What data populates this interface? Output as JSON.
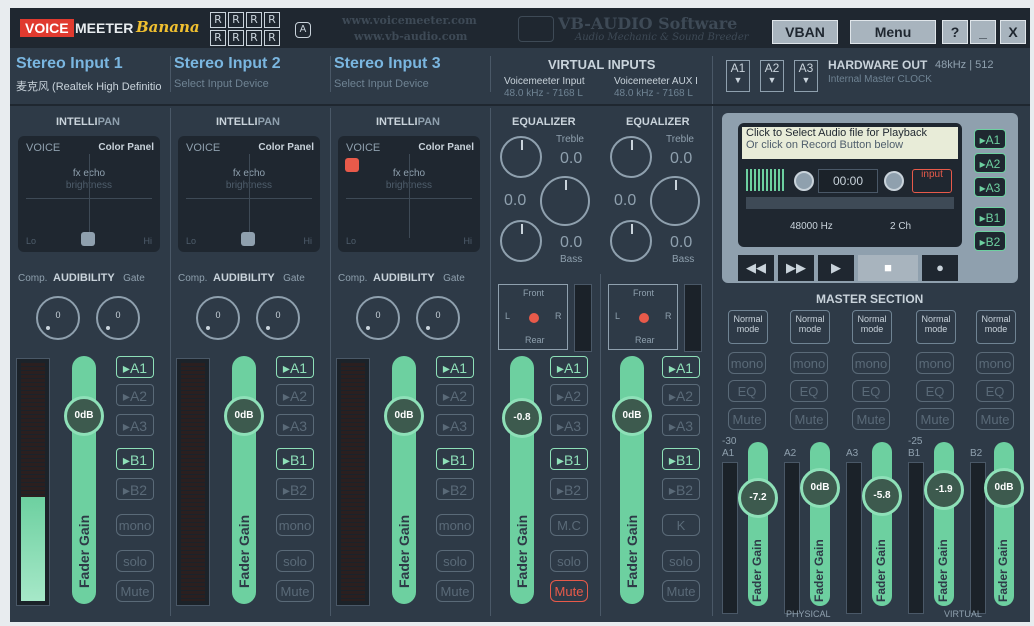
{
  "app": {
    "logo_voice": "VOICE",
    "logo_meeter": "MEETER",
    "logo_banana": "Banana",
    "r_badge": "R",
    "a_badge": "A",
    "watermark_url1": "www.voicemeeter.com",
    "watermark_url2": "www.vb-audio.com",
    "watermark_brand": "VB-AUDIO Software",
    "watermark_slogan": "Audio Mechanic & Sound Breeder",
    "vban": "VBAN",
    "menu": "Menu",
    "help": "?",
    "minimize": "_",
    "close": "X"
  },
  "strips": [
    {
      "title": "Stereo Input 1",
      "sub": "麦克风 (Realtek High Definitio",
      "fader": "0dB"
    },
    {
      "title": "Stereo Input 2",
      "sub": "Select Input Device",
      "fader": "0dB"
    },
    {
      "title": "Stereo Input 3",
      "sub": "Select Input Device",
      "fader": "0dB"
    }
  ],
  "labels": {
    "intellipan_a": "INTELLI",
    "intellipan_b": "PAN",
    "voice": "VOICE",
    "color_panel": "Color Panel",
    "fx_echo": "fx echo",
    "brightness": "brightness",
    "lo": "Lo",
    "hi": "Hi",
    "comp": "Comp.",
    "audibility": "AUDIBILITY",
    "gate": "Gate",
    "knob_zero": "0",
    "fader_gain": "Fader Gain",
    "a1": "▸A1",
    "a2": "▸A2",
    "a3": "▸A3",
    "b1": "▸B1",
    "b2": "▸B2",
    "mono": "mono",
    "solo": "solo",
    "mute": "Mute",
    "mc": "M.C",
    "k": "K",
    "equalizer": "EQUALIZER",
    "treble": "Treble",
    "bass": "Bass",
    "eq_zero": "0.0",
    "front": "Front",
    "rear": "Rear",
    "l": "L",
    "r": "R"
  },
  "virtual_inputs": {
    "title": "VIRTUAL INPUTS",
    "ch1_name": "Voicemeeter Input",
    "ch1_info": "48.0 kHz - 7168 L",
    "ch2_name": "Voicemeeter AUX I",
    "ch2_info": "48.0 kHz - 7168 L",
    "ch1_fader": "-0.8",
    "ch2_fader": "0dB"
  },
  "hardware_out": {
    "a1": "A1",
    "a2": "A2",
    "a3": "A3",
    "title": "HARDWARE OUT",
    "rate": "48kHz | 512",
    "clock": "Internal Master CLOCK"
  },
  "player": {
    "line1": "Click to Select Audio file for Playback",
    "line2": "Or click on Record Button below",
    "time": "00:00",
    "input": "input",
    "rate": "48000 Hz",
    "channels": "2 Ch",
    "rewind": "◀◀",
    "forward": "▶▶",
    "play": "▶",
    "stop": "■",
    "record": "●",
    "bus_a1": "▸A1",
    "bus_a2": "▸A2",
    "bus_a3": "▸A3",
    "bus_b1": "▸B1",
    "bus_b2": "▸B2"
  },
  "master": {
    "title": "MASTER SECTION",
    "normal_mode": "Normal mode",
    "mono": "mono",
    "eq": "EQ",
    "mute": "Mute",
    "label_a1": "A1",
    "label_a2": "A2",
    "label_a3": "A3",
    "label_b1": "B1",
    "label_b2": "B2",
    "scale_a": "-30",
    "scale_b": "-25",
    "physical": "PHYSICAL",
    "virtual": "VIRTUAL",
    "fader_gain": "Fader Gain",
    "faders": [
      "-7.2",
      "0dB",
      "-5.8",
      "-1.9",
      "0dB"
    ]
  }
}
